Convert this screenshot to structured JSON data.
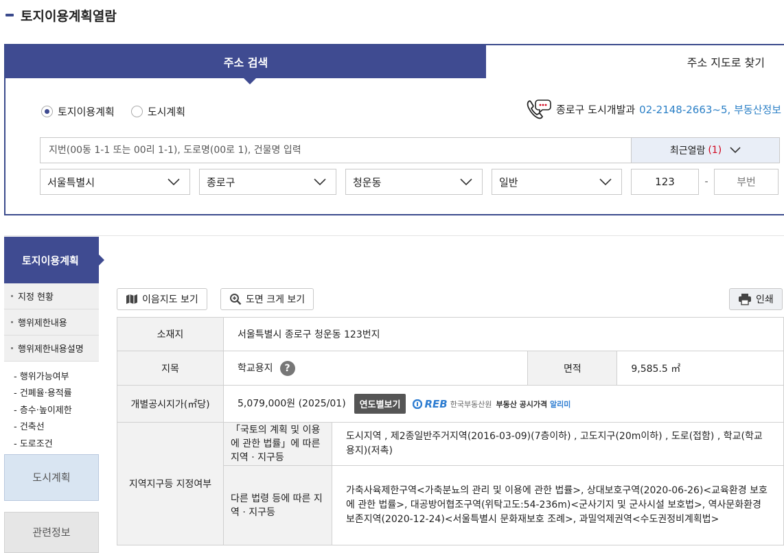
{
  "page_title": "토지이용계획열람",
  "tabs": [
    {
      "label": "주소 검색"
    },
    {
      "label": "주소 지도로 찾기"
    }
  ],
  "radios": [
    {
      "label": "토지이용계획",
      "checked": true
    },
    {
      "label": "도시계획",
      "checked": false
    }
  ],
  "contact": {
    "label": "종로구 도시개발과",
    "number": "02-2148-2663~5, 부동산정보"
  },
  "search": {
    "placeholder": "지번(00동 1-1 또는 00리 1-1), 도로명(00로 1), 건물명 입력",
    "recent_label": "최근열람",
    "recent_count": "(1)"
  },
  "selects": {
    "city": "서울특별시",
    "district": "종로구",
    "dong": "청운동",
    "type": "일반",
    "main_number": "123",
    "dash": "-",
    "sub_placeholder": "부번"
  },
  "sidebar": {
    "head": "토지이용계획",
    "items": [
      "지정 현황",
      "행위제한내용",
      "행위제한내용설명"
    ],
    "sub_items": [
      "- 행위가능여부",
      "- 건폐율·용적률",
      "- 층수·높이제한",
      "- 건축선",
      "- 도로조건"
    ],
    "city_plan": "도시계획",
    "related": "관련정보"
  },
  "buttons": {
    "map": "이음지도 보기",
    "zoom": "도면 크게 보기",
    "print": "인쇄"
  },
  "info": {
    "location_label": "소재지",
    "location": "서울특별시 종로구 청운동 123번지",
    "jimok_label": "지목",
    "jimok": "학교용지",
    "qmark": "?",
    "area_label": "면적",
    "area": "9,585.5 ㎡",
    "price_label": "개별공시지가(㎡당)",
    "price": "5,079,000원 (2025/01)",
    "year_btn": "연도별보기",
    "reb_logo": "REB",
    "reb_kr": "한국부동산원",
    "reb_alimi_pre": "부동산 공시가격 ",
    "reb_alimi": "알리미",
    "zone_label": "지역지구등 지정여부",
    "zone_sub1": "「국토의 계획 및 이용에 관한 법률」에 따른 지역 · 지구등",
    "zone_val1": "도시지역 , 제2종일반주거지역(2016-03-09)(7층이하) , 고도지구(20m이하) , 도로(접함) , 학교(학교용지)(저촉)",
    "zone_sub2": "다른 법령 등에 따른 지역 · 지구등",
    "zone_val2": "가축사육제한구역<가축분뇨의 관리 및 이용에 관한 법률>, 상대보호구역(2020-06-26)<교육환경 보호에 관한 법률>, 대공방어협조구역(위탁고도:54-236m)<군사기지 및 군사시설 보호법>, 역사문화환경보존지역(2020-12-24)<서울특별시 문화재보호 조례>, 과밀억제권역<수도권정비계획법>"
  },
  "colors": {
    "primary": "#3f4b91",
    "phone": "#2a7fc6",
    "count": "#d0021b",
    "city_plan_bg": "#d9e5f2"
  }
}
